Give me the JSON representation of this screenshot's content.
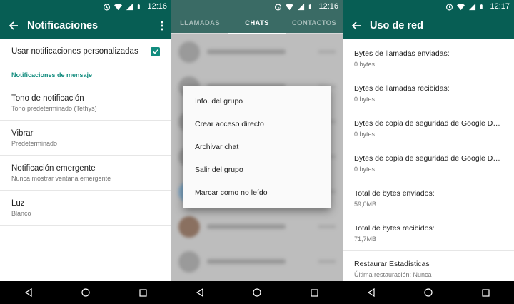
{
  "colors": {
    "primary": "#075e54",
    "accent": "#128c7e"
  },
  "status": {
    "time_1": "12:16",
    "time_2": "12:16",
    "time_3": "12:17"
  },
  "notifications": {
    "title": "Notificaciones",
    "custom_toggle_label": "Usar notificaciones personalizadas",
    "custom_toggle_checked": true,
    "section_title": "Notificaciones de mensaje",
    "prefs": [
      {
        "title": "Tono de notificación",
        "subtitle": "Tono predeterminado (Tethys)"
      },
      {
        "title": "Vibrar",
        "subtitle": "Predeterminado"
      },
      {
        "title": "Notificación emergente",
        "subtitle": "Nunca mostrar ventana emergente"
      },
      {
        "title": "Luz",
        "subtitle": "Blanco"
      }
    ]
  },
  "chats": {
    "tabs": [
      "LLAMADAS",
      "CHATS",
      "CONTACTOS"
    ],
    "active_tab": "CHATS",
    "context_menu": [
      "Info. del grupo",
      "Crear acceso directo",
      "Archivar chat",
      "Salir del grupo",
      "Marcar como no leído"
    ]
  },
  "network": {
    "title": "Uso de red",
    "stats": [
      {
        "title": "Bytes de llamadas enviadas:",
        "value": "0 bytes"
      },
      {
        "title": "Bytes de llamadas recibidas:",
        "value": "0 bytes"
      },
      {
        "title": "Bytes de copia de seguridad de Google Dri...",
        "value": "0 bytes"
      },
      {
        "title": "Bytes de copia de seguridad de Google Dri...",
        "value": "0 bytes"
      },
      {
        "title": "Total de bytes enviados:",
        "value": "59,0MB"
      },
      {
        "title": "Total de bytes recibidos:",
        "value": "71,7MB"
      },
      {
        "title": "Restaurar Estadísticas",
        "value": "Última restauración: Nunca"
      }
    ]
  }
}
